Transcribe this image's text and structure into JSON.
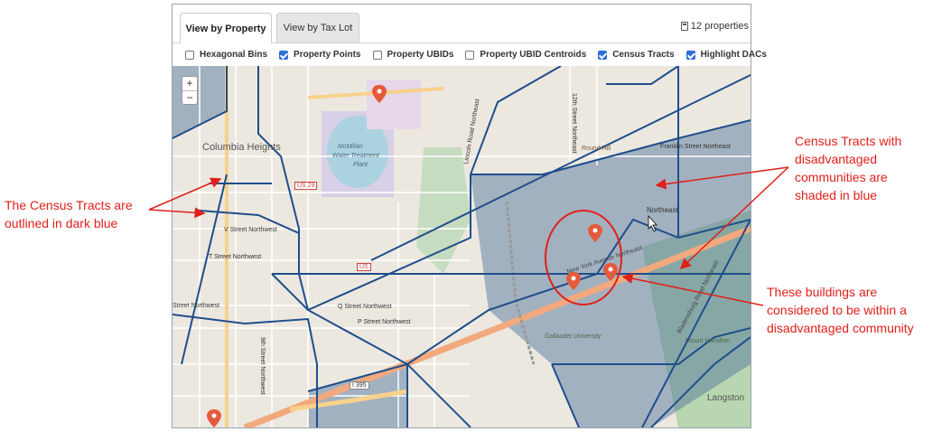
{
  "tabs": [
    {
      "label": "View by Property",
      "active": true
    },
    {
      "label": "View by Tax Lot",
      "active": false
    }
  ],
  "property_count": "12 properties",
  "layers": [
    {
      "label": "Hexagonal Bins",
      "checked": false
    },
    {
      "label": "Property Points",
      "checked": true
    },
    {
      "label": "Property UBIDs",
      "checked": false
    },
    {
      "label": "Property UBID Centroids",
      "checked": false
    },
    {
      "label": "Census Tracts",
      "checked": true
    },
    {
      "label": "Highlight DACs",
      "checked": true
    }
  ],
  "zoom": {
    "in": "+",
    "out": "−"
  },
  "map_labels": {
    "columbia_heights": "Columbia Heights",
    "mcmillan": "McMillan",
    "water_treatment": "Water Treatment",
    "plant": "Plant",
    "us29": "US 29",
    "us": "US",
    "v_street": "V Street Northwest",
    "t_street": "T Street Northwest",
    "street_nw": "Street Northwest",
    "q_street": "Q Street Northwest",
    "p_street": "P Street Northwest",
    "ninth_street": "9th Street Northwest",
    "lincoln_road": "Lincoln Road Northeast",
    "twelfth_street": "12th Street Northeast",
    "round_hill": "Round Hill",
    "franklin_street": "Franklin Street Northeast",
    "northeast": "Northeast",
    "gallaudet": "Gallaudet University",
    "mount_hamilton": "Mount Hamilton",
    "langston": "Langston",
    "i395": "I 395",
    "ny_ave": "New York Avenue Northeast",
    "bladensburg": "Bladensburg Road Northeast"
  },
  "annotations": {
    "left": [
      "The Census Tracts are",
      "outlined in dark blue"
    ],
    "right_top": [
      "Census Tracts with",
      "disadvantaged",
      "communities are",
      "shaded in blue"
    ],
    "right_bottom": [
      "These buildings are",
      "considered to be within a",
      "disadvantaged community"
    ]
  },
  "colors": {
    "tract_outline": "#1f4e8c",
    "dac_fill": "#4a6f99",
    "marker": "#e45a3c",
    "annotation": "#e0201a",
    "checkbox": "#2f6fd6"
  }
}
